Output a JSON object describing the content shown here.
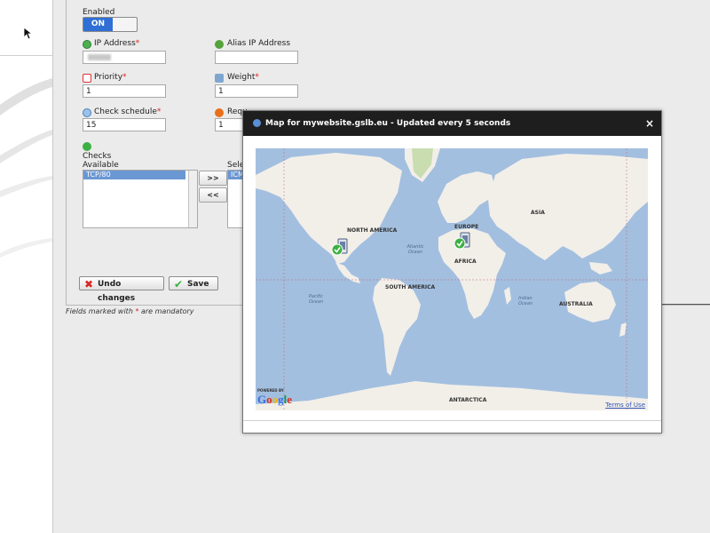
{
  "form": {
    "enabled_label": "Enabled",
    "toggle_on": "ON",
    "ip_label": "IP Address",
    "ip_required": "*",
    "ip_value": "",
    "alias_label": "Alias IP Address",
    "alias_value": "",
    "priority_label": "Priority",
    "priority_required": "*",
    "priority_value": "1",
    "weight_label": "Weight",
    "weight_required": "*",
    "weight_value": "1",
    "schedule_label": "Check schedule",
    "schedule_required": "*",
    "schedule_value": "15",
    "hidden_label_partial": "Requ",
    "hidden_value": "1",
    "checks_label": "Checks",
    "available_label": "Available",
    "available_items": [
      "TCP/80"
    ],
    "selected_label_partial": "Sele",
    "selected_items": [
      "ICM"
    ],
    "add_btn": ">>",
    "remove_btn": "<<",
    "undo_btn": "Undo changes",
    "save_btn": "Save"
  },
  "footer": {
    "note_prefix": "Fields marked with ",
    "note_star": "*",
    "note_suffix": " are mandatory"
  },
  "dialog": {
    "title": "Map for mywebsite.gslb.eu - Updated every 5 seconds",
    "close": "×",
    "map": {
      "continents": [
        "NORTH AMERICA",
        "SOUTH AMERICA",
        "EUROPE",
        "AFRICA",
        "ASIA",
        "AUSTRALIA",
        "ANTARCTICA"
      ],
      "oceans": [
        "Atlantic Ocean",
        "Pacific Ocean",
        "Indian Ocean"
      ],
      "powered_by": "POWERED BY",
      "google": "Google",
      "terms": "Terms of Use"
    }
  },
  "colors": {
    "toggle_on": "#2f6fd6",
    "dialog_title_bg": "#1e1e1e",
    "map_water": "#a3bfe0",
    "map_land": "#f2efe9",
    "required": "#dd2222",
    "status_ok": "#3cb043"
  }
}
